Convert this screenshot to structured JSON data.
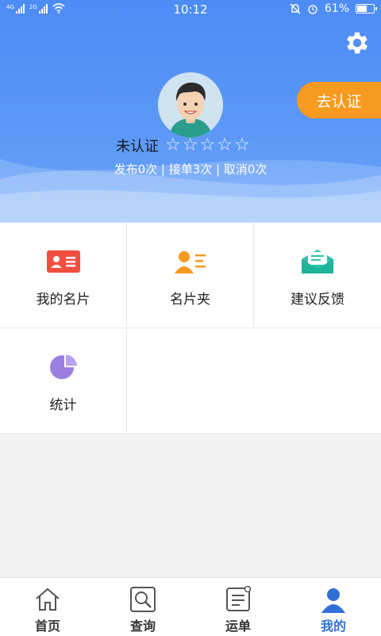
{
  "status_bar": {
    "time": "10:12",
    "signal1_label": "4G",
    "signal2_label": "2G",
    "battery": "61%",
    "battery_level": 0.61
  },
  "profile": {
    "certify_label": "去认证",
    "status_text": "未认证",
    "rating_stars": 5,
    "rating_value": 0,
    "stats": {
      "published": "发布0次",
      "sep1": " | ",
      "accepted": "接单3次",
      "sep2": " | ",
      "cancelled": "取消0次"
    }
  },
  "menu": [
    {
      "label": "我的名片",
      "icon": "id-card-icon"
    },
    {
      "label": "名片夹",
      "icon": "contacts-icon"
    },
    {
      "label": "建议反馈",
      "icon": "feedback-mail-icon"
    },
    {
      "label": "统计",
      "icon": "pie-chart-icon"
    }
  ],
  "bottom_nav": [
    {
      "label": "首页",
      "icon": "home-icon"
    },
    {
      "label": "查询",
      "icon": "search-icon"
    },
    {
      "label": "运单",
      "icon": "waybill-icon"
    },
    {
      "label": "我的",
      "icon": "user-icon"
    }
  ],
  "colors": {
    "header": "#4d8cf5",
    "accent_orange": "#f79a1f",
    "active_tab": "#2f6fd6"
  }
}
